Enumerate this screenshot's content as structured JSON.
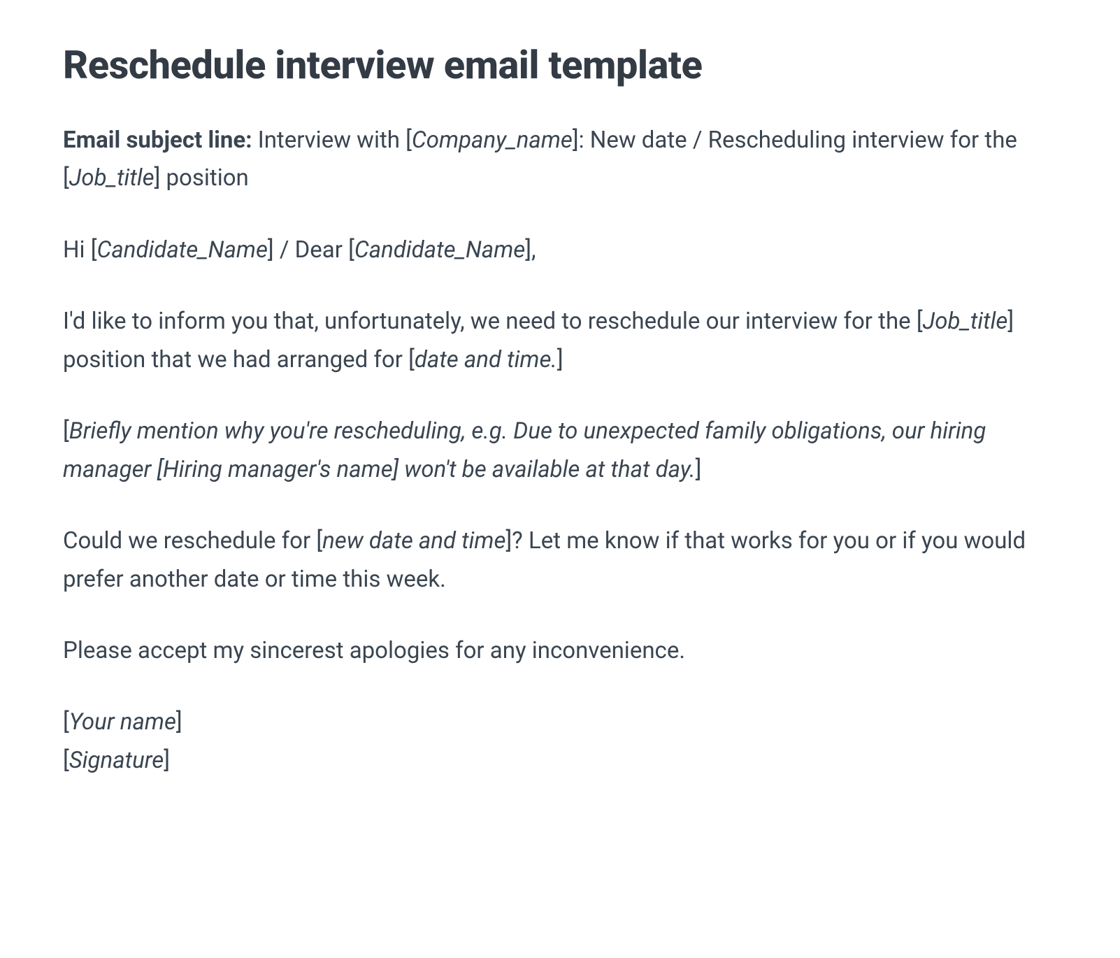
{
  "title": "Reschedule interview email template",
  "subject": {
    "label": "Email subject line:",
    "part1": " Interview with [",
    "placeholder1": "Company_name",
    "part2": "]: New date / Rescheduling interview for the [",
    "placeholder2": "Job_title",
    "part3": "] position"
  },
  "greeting": {
    "part1": "Hi [",
    "placeholder1": "Candidate_Name",
    "part2": "] / Dear [",
    "placeholder2": "Candidate_Name",
    "part3": "],"
  },
  "body1": {
    "part1": "I'd like to inform you that, unfortunately, we need to reschedule our interview for the [",
    "placeholder1": "Job_title",
    "part2": "] position that we had arranged for [",
    "placeholder2": "date and time.",
    "part3": "]"
  },
  "body2": {
    "part1": "[",
    "placeholder1": "Briefly mention why you're rescheduling, e.g. Due to unexpected family obligations, our hiring manager [Hiring manager's name] won't be available at that day.",
    "part2": "]"
  },
  "body3": {
    "part1": "Could we reschedule for [",
    "placeholder1": "new date and time",
    "part2": "]? Let me know if that works for you or if you would prefer another date or time this week."
  },
  "body4": "Please accept my sincerest apologies for any inconvenience.",
  "signature": {
    "line1_part1": "[",
    "line1_placeholder": "Your name",
    "line1_part2": "]",
    "line2_part1": "[",
    "line2_placeholder": "Signature",
    "line2_part2": "]"
  }
}
